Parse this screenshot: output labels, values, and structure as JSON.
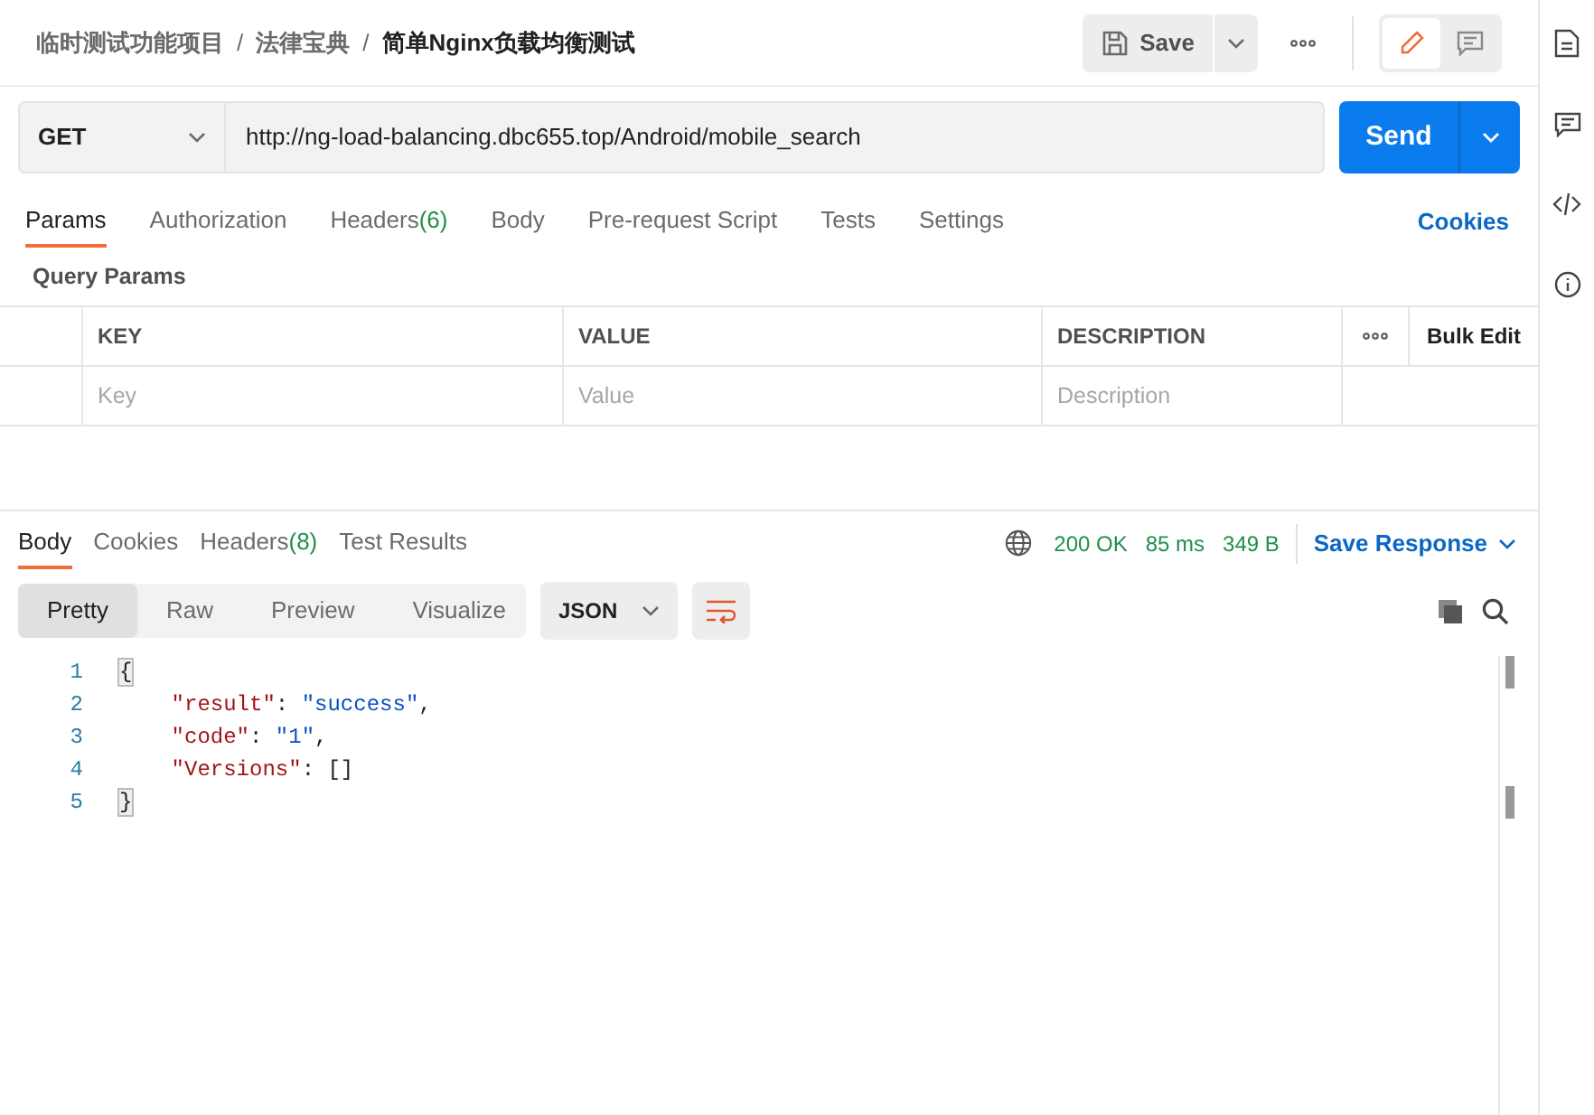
{
  "breadcrumb": [
    "临时测试功能项目",
    "法律宝典",
    "简单Nginx负载均衡测试"
  ],
  "breadcrumb_separator": "/",
  "editor_modes": [
    {
      "kind": "edit",
      "selected": true
    },
    {
      "kind": "comments",
      "selected": false
    }
  ],
  "save_button": "Save",
  "request": {
    "method": "GET",
    "url": "http://ng-load-balancing.dbc655.top/Android/mobile_search",
    "send": "Send"
  },
  "request_tabs": [
    {
      "label": "Params",
      "selected": true
    },
    {
      "label": "Authorization",
      "selected": false
    },
    {
      "label": "Headers",
      "count": "(6)",
      "selected": false
    },
    {
      "label": "Body",
      "selected": false
    },
    {
      "label": "Pre-request Script",
      "selected": false
    },
    {
      "label": "Tests",
      "selected": false
    },
    {
      "label": "Settings",
      "selected": false
    }
  ],
  "cookies_link": "Cookies",
  "query_params": {
    "title": "Query Params",
    "columns": [
      "KEY",
      "VALUE",
      "DESCRIPTION"
    ],
    "bulk_edit": "Bulk Edit",
    "placeholders": [
      "Key",
      "Value",
      "Description"
    ]
  },
  "response_tabs": [
    {
      "label": "Body",
      "selected": true
    },
    {
      "label": "Cookies",
      "selected": false
    },
    {
      "label": "Headers",
      "count": "(8)",
      "selected": false
    },
    {
      "label": "Test Results",
      "selected": false
    }
  ],
  "status": {
    "code": "200 OK",
    "time": "85 ms",
    "size": "349 B"
  },
  "save_response": "Save Response",
  "view_modes": [
    {
      "label": "Pretty",
      "selected": true
    },
    {
      "label": "Raw",
      "selected": false
    },
    {
      "label": "Preview",
      "selected": false
    },
    {
      "label": "Visualize",
      "selected": false
    }
  ],
  "format": "JSON",
  "code_lines": [
    {
      "number": "1",
      "tokens": [
        {
          "text": "{",
          "kind": "bracket"
        }
      ]
    },
    {
      "number": "2",
      "tokens": [
        {
          "text": "    \"result\"",
          "kind": "key"
        },
        {
          "text": ": ",
          "kind": "punct"
        },
        {
          "text": "\"success\"",
          "kind": "string"
        },
        {
          "text": ",",
          "kind": "punct"
        }
      ]
    },
    {
      "number": "3",
      "tokens": [
        {
          "text": "    \"code\"",
          "kind": "key"
        },
        {
          "text": ": ",
          "kind": "punct"
        },
        {
          "text": "\"1\"",
          "kind": "string"
        },
        {
          "text": ",",
          "kind": "punct"
        }
      ]
    },
    {
      "number": "4",
      "tokens": [
        {
          "text": "    \"Versions\"",
          "kind": "key"
        },
        {
          "text": ": []",
          "kind": "punct"
        }
      ]
    },
    {
      "number": "5",
      "tokens": [
        {
          "text": "}",
          "kind": "bracket"
        }
      ]
    }
  ]
}
